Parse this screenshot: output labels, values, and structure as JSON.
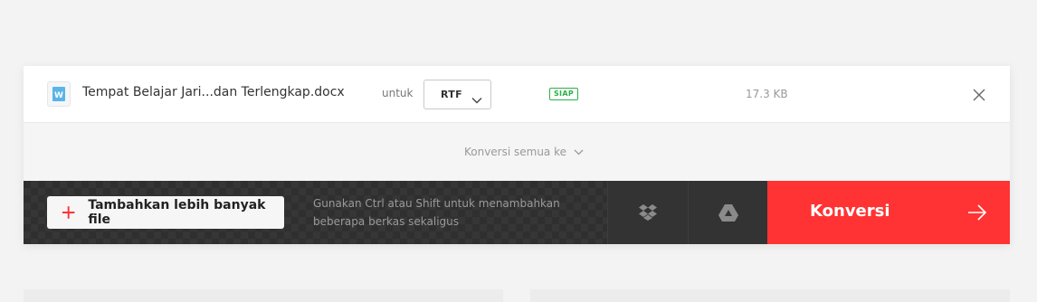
{
  "file": {
    "name": "Tempat Belajar Jari...dan Terlengkap.docx",
    "icon": "word-doc-icon",
    "to_label": "untuk",
    "format": "RTF",
    "status": "SIAP",
    "size": "17.3 KB"
  },
  "convert_all": {
    "label": "Konversi semua ke"
  },
  "toolbar": {
    "add_label": "Tambahkan lebih banyak file",
    "hint": "Gunakan Ctrl atau Shift untuk menambahkan beberapa berkas sekaligus",
    "convert_label": "Konversi"
  },
  "colors": {
    "accent": "#ff3333",
    "status": "#2bb04a",
    "bar_bg": "#2f2f2f"
  }
}
